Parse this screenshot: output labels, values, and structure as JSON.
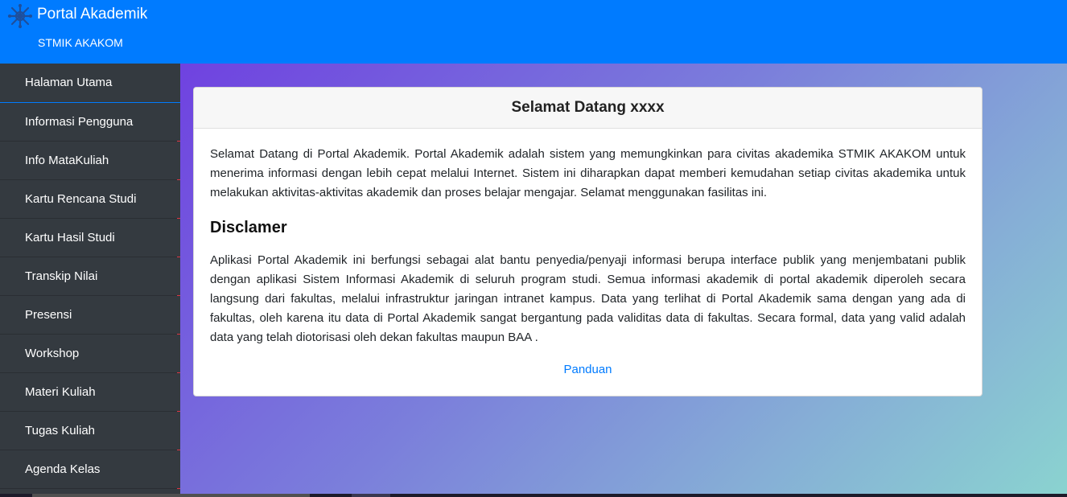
{
  "header": {
    "title": "Portal Akademik",
    "subtitle": "STMIK AKAKOM",
    "logo_icon": "snowflake-logo-icon",
    "background_color": "#007bff"
  },
  "sidebar": {
    "background_color": "#343a40",
    "items": [
      {
        "label": "Halaman Utama",
        "active": true
      },
      {
        "label": "Informasi Pengguna"
      },
      {
        "label": "Info MataKuliah"
      },
      {
        "label": "Kartu Rencana Studi"
      },
      {
        "label": "Kartu Hasil Studi"
      },
      {
        "label": "Transkip Nilai"
      },
      {
        "label": "Presensi"
      },
      {
        "label": "Workshop"
      },
      {
        "label": "Materi Kuliah"
      },
      {
        "label": "Tugas Kuliah"
      },
      {
        "label": "Agenda Kelas"
      }
    ]
  },
  "card": {
    "title": "Selamat Datang xxxx",
    "intro": "Selamat Datang di Portal Akademik. Portal Akademik adalah sistem yang memungkinkan para civitas akademika STMIK AKAKOM untuk menerima informasi dengan lebih cepat melalui Internet. Sistem ini diharapkan dapat memberi kemudahan setiap civitas akademika untuk melakukan aktivitas-aktivitas akademik dan proses belajar mengajar. Selamat menggunakan fasilitas ini.",
    "disclaimer_title": "Disclamer",
    "disclaimer_text": "Aplikasi Portal Akademik ini berfungsi sebagai alat bantu penyedia/penyaji informasi berupa interface publik yang menjembatani publik dengan aplikasi Sistem Informasi Akademik di seluruh program studi. Semua informasi akademik di portal akademik diperoleh secara langsung dari fakultas, melalui infrastruktur jaringan intranet kampus. Data yang terlihat di Portal Akademik sama dengan yang ada di fakultas, oleh karena itu data di Portal Akademik sangat bergantung pada validitas data di fakultas. Secara formal, data yang valid adalah data yang telah diotorisasi oleh dekan fakultas maupun BAA .",
    "guide_link": "Panduan",
    "link_color": "#007bff"
  }
}
